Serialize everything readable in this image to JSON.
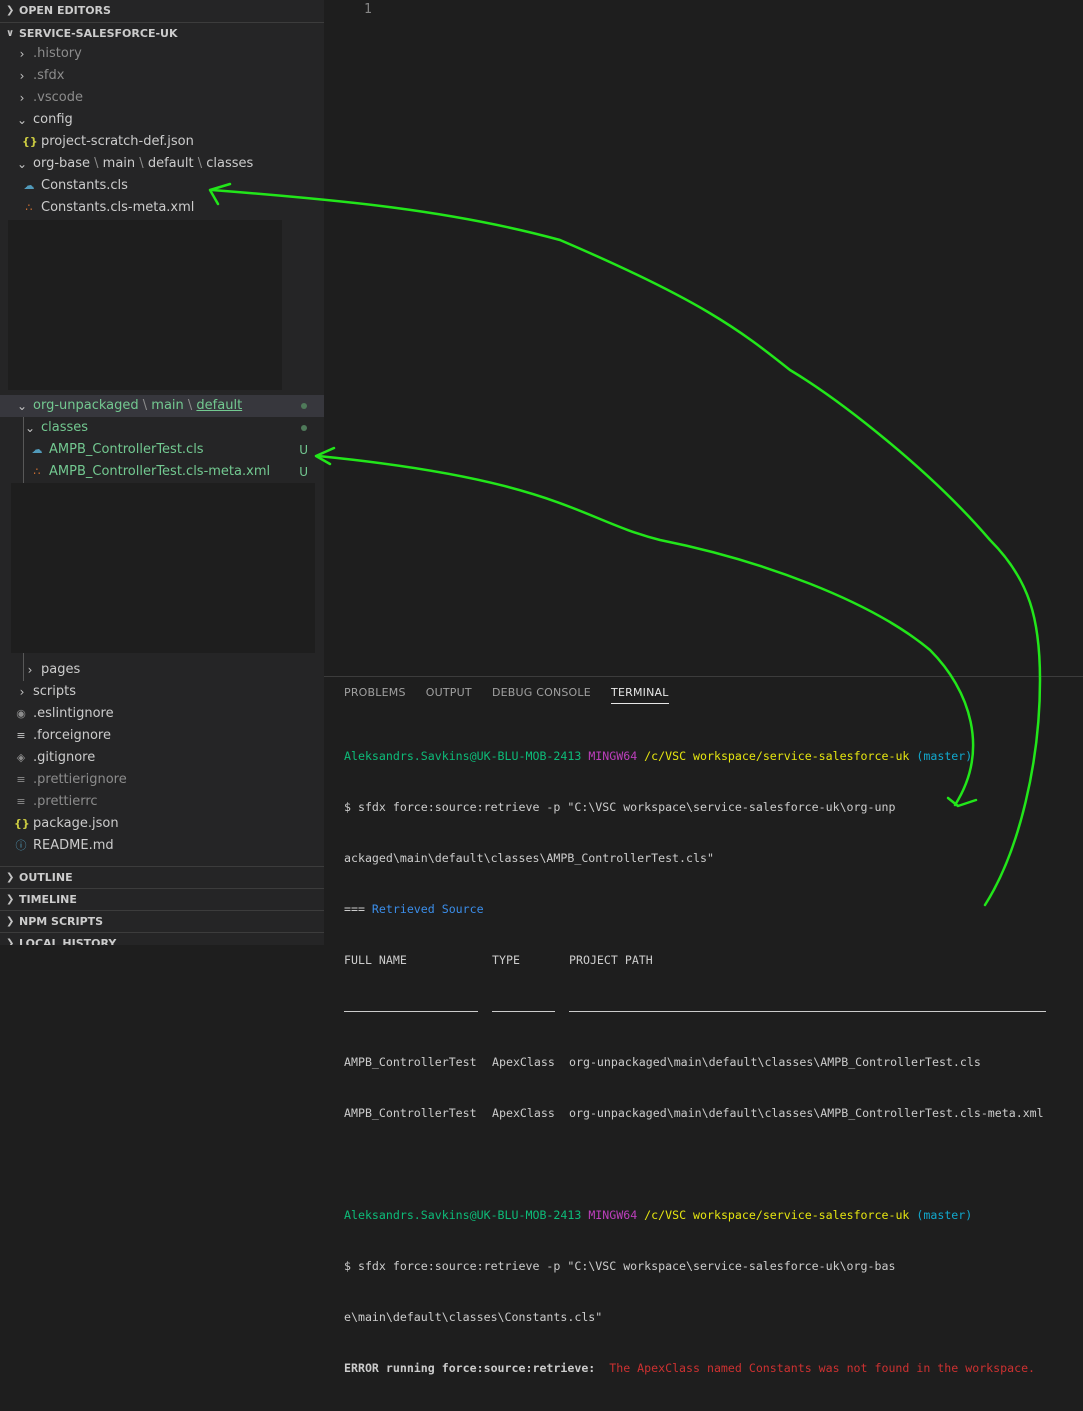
{
  "sidebar": {
    "open_editors": "OPEN EDITORS",
    "workspace": "SERVICE-SALESFORCE-UK",
    "items": {
      "history": ".history",
      "sfdx": ".sfdx",
      "vscode": ".vscode",
      "config": "config",
      "scratch_def": "project-scratch-def.json",
      "org_base_1": "org-base",
      "org_base_2": "main",
      "org_base_3": "default",
      "org_base_4": "classes",
      "constants": "Constants.cls",
      "constants_meta": "Constants.cls-meta.xml",
      "org_unp_1": "org-unpackaged",
      "org_unp_2": "main",
      "org_unp_3": "default",
      "classes": "classes",
      "ampb": "AMPB_ControllerTest.cls",
      "ampb_meta": "AMPB_ControllerTest.cls-meta.xml",
      "untracked": "U",
      "pages": "pages",
      "scripts": "scripts",
      "eslintignore": ".eslintignore",
      "forceignore": ".forceignore",
      "gitignore": ".gitignore",
      "prettierignore": ".prettierignore",
      "prettierrc": ".prettierrc",
      "package_json": "package.json",
      "readme": "README.md"
    },
    "sections": {
      "outline": "OUTLINE",
      "timeline": "TIMELINE",
      "npm": "NPM SCRIPTS",
      "local_history": "LOCAL HISTORY"
    }
  },
  "editor": {
    "line_number": "1"
  },
  "panel": {
    "tabs": [
      "PROBLEMS",
      "OUTPUT",
      "DEBUG CONSOLE",
      "TERMINAL"
    ],
    "active_tab": "TERMINAL"
  },
  "terminal": {
    "user_host": "Aleksandrs.Savkins@UK-BLU-MOB-2413",
    "shell": "MINGW64",
    "path": "/c/VSC workspace/service-salesforce-uk",
    "branch": "(master)",
    "cmd1_a": "$ sfdx force:source:retrieve -p \"C:\\VSC workspace\\service-salesforce-uk\\org-unp",
    "cmd1_b": "ackaged\\main\\default\\classes\\AMPB_ControllerTest.cls\"",
    "retrieved_prefix": "=== ",
    "retrieved_title": "Retrieved Source",
    "col_full_name": "FULL NAME",
    "col_type": "TYPE",
    "col_project_path": "PROJECT PATH",
    "rows": [
      {
        "name": "AMPB_ControllerTest",
        "type": "ApexClass",
        "path": "org-unpackaged\\main\\default\\classes\\AMPB_ControllerTest.cls"
      },
      {
        "name": "AMPB_ControllerTest",
        "type": "ApexClass",
        "path": "org-unpackaged\\main\\default\\classes\\AMPB_ControllerTest.cls-meta.xml"
      }
    ],
    "cmd2_a": "$ sfdx force:source:retrieve -p \"C:\\VSC workspace\\service-salesforce-uk\\org-bas",
    "cmd2_b": "e\\main\\default\\classes\\Constants.cls\"",
    "error_label": "ERROR running force:source:retrieve:",
    "error_msg": "The ApexClass named Constants was not found in the workspace."
  },
  "colors": {
    "annotation_arrow": "#22e61a",
    "sidebar_bg": "#252526",
    "editor_bg": "#1e1e1e",
    "git_untracked": "#73c991"
  }
}
